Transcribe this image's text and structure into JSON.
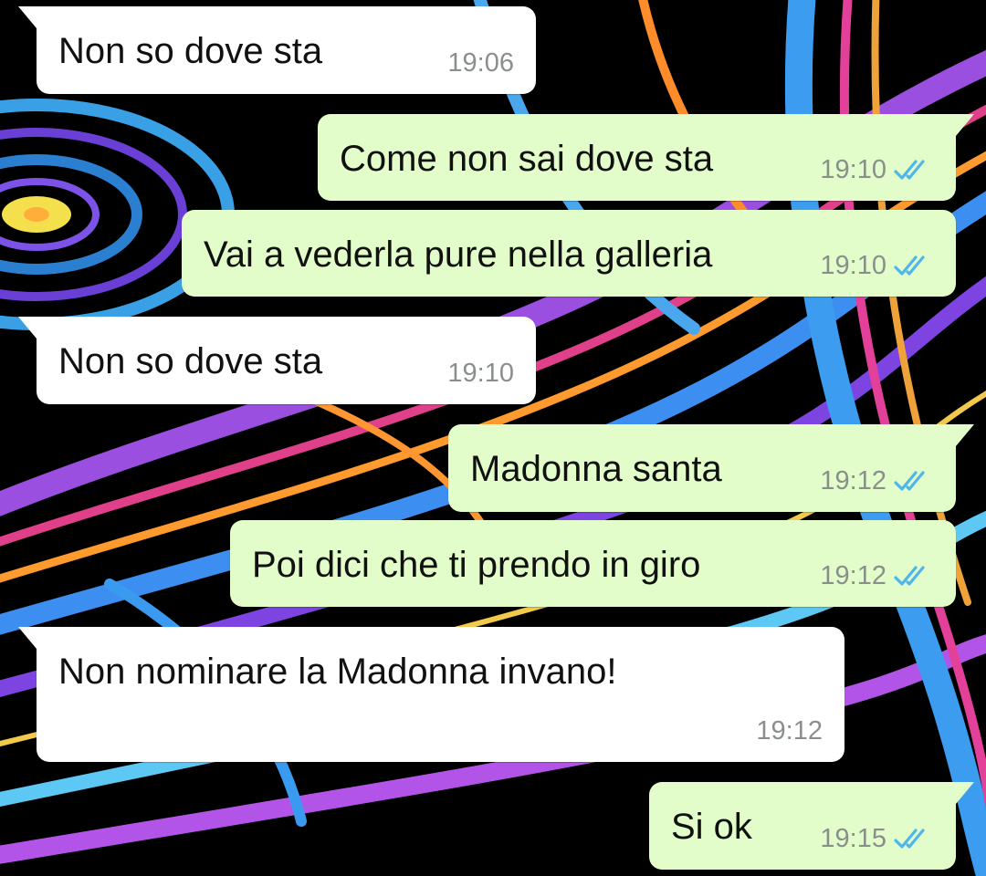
{
  "chat": {
    "messages": [
      {
        "text": "Non so dove sta",
        "time": "19:06"
      },
      {
        "text": "Come non sai dove sta",
        "time": "19:10",
        "status_icon": "double-check-read"
      },
      {
        "text": "Vai a vederla pure nella galleria",
        "time": "19:10",
        "status_icon": "double-check-read"
      },
      {
        "text": "Non so dove sta",
        "time": "19:10"
      },
      {
        "text": "Madonna santa",
        "time": "19:12",
        "status_icon": "double-check-read"
      },
      {
        "text": "Poi dici che ti prendo in giro",
        "time": "19:12",
        "status_icon": "double-check-read"
      },
      {
        "text": "Non nominare la Madonna invano!",
        "time": "19:12"
      },
      {
        "text": "Si ok",
        "time": "19:15",
        "status_icon": "double-check-read"
      }
    ]
  },
  "colors": {
    "incoming_bubble": "#ffffff",
    "outgoing_bubble": "#e2fdc9",
    "read_check": "#4fb6ec",
    "timestamp": "#8a8f8c"
  }
}
